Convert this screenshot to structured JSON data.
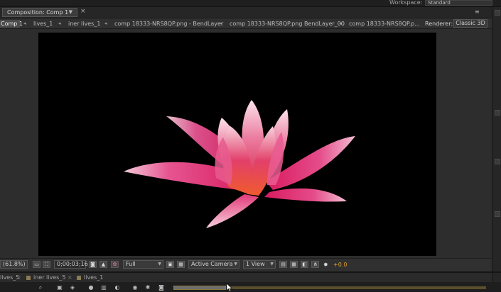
{
  "workspace": {
    "label": "Workspace:",
    "value": "Standard"
  },
  "composition_tab": {
    "title": "Composition: Comp 1",
    "close_glyph": "×"
  },
  "panel_menu_glyph": "≡",
  "breadcrumbs": [
    "Comp 1",
    "lives_1",
    "iner lives_1",
    "comp 18333-NRS8QP.png - BendLayer",
    "comp 18333-NRS8QP.png BendLayer_00",
    "comp 18333-NRS8QP.p..."
  ],
  "renderer": {
    "label": "Renderer:",
    "value": "Classic 3D"
  },
  "viewer_toolbar": {
    "magnification": "(61.8%)",
    "timecode": "0;00;03;16",
    "resolution": "Full",
    "camera": "Active Camera",
    "views": "1 View",
    "exposure": "+0.0"
  },
  "timeline_tabs": [
    "lives_5",
    "iner lives_5",
    "lives_1"
  ],
  "colors": {
    "canvas_bg": "#000000",
    "petal_pink": "#e2327a",
    "petal_light": "#f6d7e2",
    "accent_orange": "#e0a030"
  },
  "icons": {
    "close": "close-icon",
    "menu": "panel-menu-icon",
    "snapshot": "camera-icon",
    "grid": "grid-icon",
    "exposure": "exposure-icon"
  }
}
